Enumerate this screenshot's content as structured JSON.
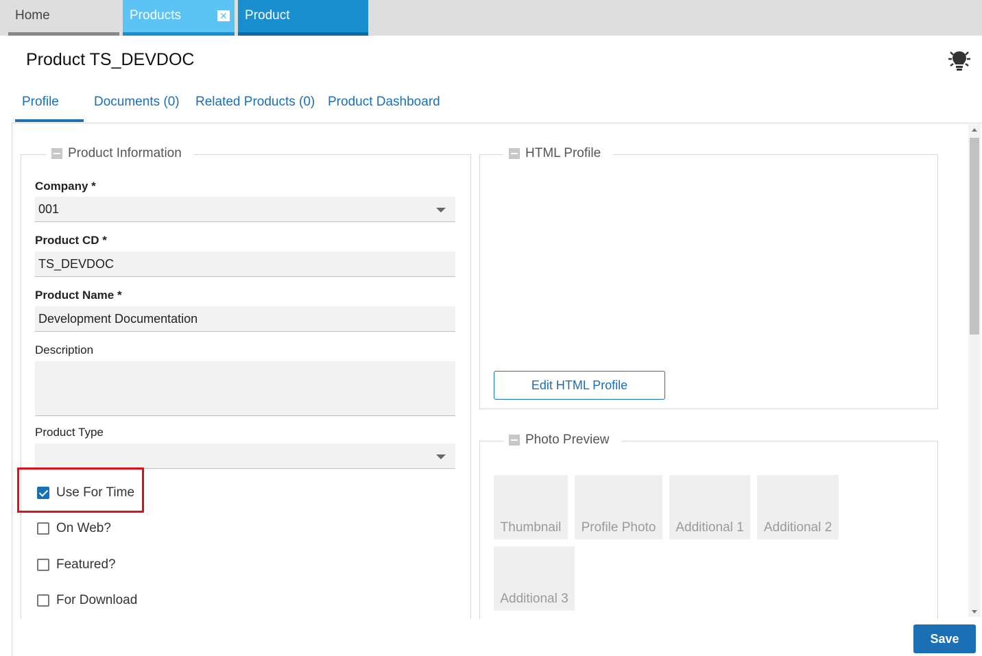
{
  "top_tabs": {
    "home": "Home",
    "products": "Products",
    "product": "Product TS_DEVDOC"
  },
  "header": {
    "title": "Product TS_DEVDOC",
    "help_icon": "lightbulb-icon"
  },
  "sub_tabs": {
    "profile": "Profile",
    "documents": "Documents (0)",
    "related": "Related Products (0)",
    "dashboard": "Product Dashboard"
  },
  "product_info": {
    "legend": "Product Information",
    "company_label": "Company *",
    "company_value": "001",
    "product_cd_label": "Product CD *",
    "product_cd_value": "TS_DEVDOC",
    "product_name_label": "Product Name *",
    "product_name_value": "Development Documentation",
    "description_label": "Description",
    "description_value": "",
    "product_type_label": "Product Type",
    "product_type_value": ""
  },
  "checkboxes": {
    "use_for_time": {
      "label": "Use For Time",
      "checked": true
    },
    "on_web": {
      "label": "On Web?",
      "checked": false
    },
    "featured": {
      "label": "Featured?",
      "checked": false
    },
    "for_download": {
      "label": "For Download",
      "checked": false
    }
  },
  "html_profile": {
    "legend": "HTML Profile",
    "edit_button": "Edit HTML Profile"
  },
  "photo_preview": {
    "legend": "Photo Preview",
    "thumbnail": "Thumbnail",
    "profile_photo": "Profile Photo",
    "additional_1": "Additional 1",
    "additional_2": "Additional 2",
    "additional_3": "Additional 3"
  },
  "footer": {
    "save": "Save"
  },
  "colors": {
    "accent": "#1a6fb5",
    "highlight": "#e0101a",
    "active_tab": "#1a8fd0",
    "products_tab": "#5bc4f5"
  }
}
